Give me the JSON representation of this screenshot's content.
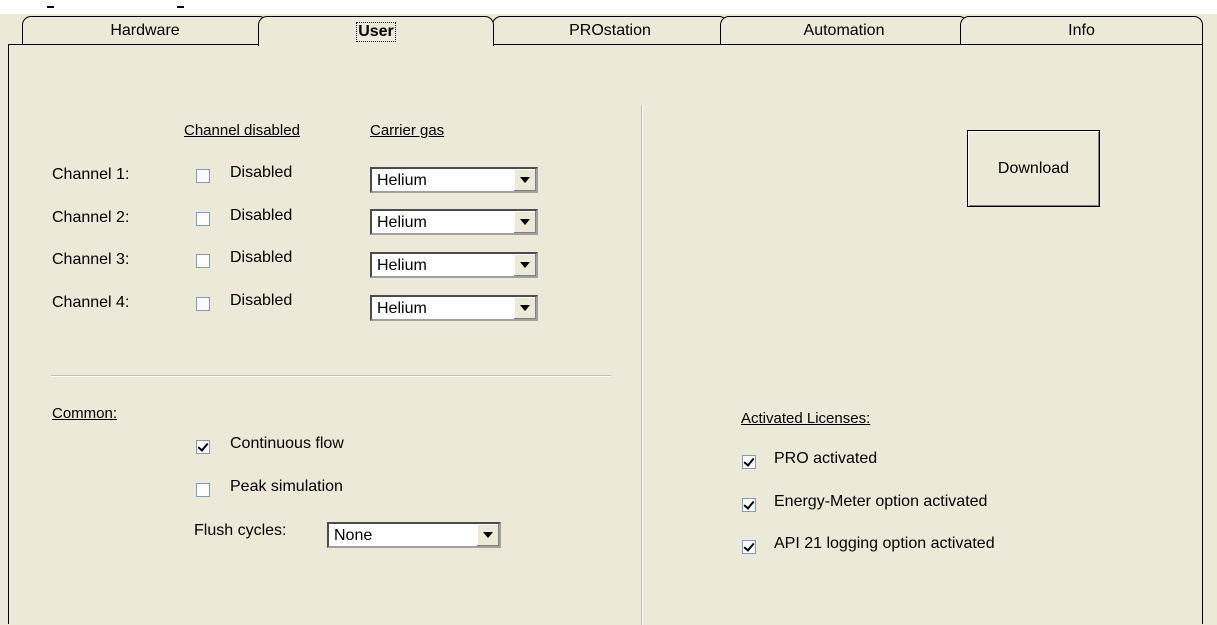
{
  "tabs": [
    {
      "label": "Hardware"
    },
    {
      "label": "User"
    },
    {
      "label": "PROstation"
    },
    {
      "label": "Automation"
    },
    {
      "label": "Info"
    }
  ],
  "channels": {
    "header_disabled": "Channel disabled",
    "header_gas": "Carrier gas",
    "rows": [
      {
        "label": "Channel 1:",
        "checkbox_label": "Disabled",
        "checked": false,
        "gas": "Helium"
      },
      {
        "label": "Channel 2:",
        "checkbox_label": "Disabled",
        "checked": false,
        "gas": "Helium"
      },
      {
        "label": "Channel 3:",
        "checkbox_label": "Disabled",
        "checked": false,
        "gas": "Helium"
      },
      {
        "label": "Channel 4:",
        "checkbox_label": "Disabled",
        "checked": false,
        "gas": "Helium"
      }
    ]
  },
  "common": {
    "title": "Common:",
    "continuous_flow": {
      "label": "Continuous flow",
      "checked": true
    },
    "peak_simulation": {
      "label": "Peak simulation",
      "checked": false
    },
    "flush_label": "Flush cycles:",
    "flush_value": "None"
  },
  "download_label": "Download",
  "licenses": {
    "title": "Activated Licenses:",
    "items": [
      {
        "label": "PRO activated",
        "checked": true
      },
      {
        "label": "Energy-Meter option activated",
        "checked": true
      },
      {
        "label": "API 21 logging option activated",
        "checked": true
      }
    ]
  }
}
